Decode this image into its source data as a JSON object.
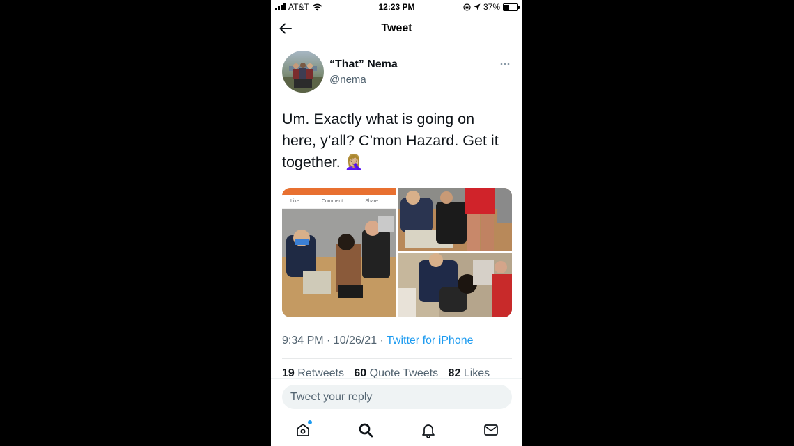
{
  "status_bar": {
    "carrier": "AT&T",
    "time": "12:23 PM",
    "battery": "37%",
    "battery_fraction": 0.37
  },
  "header": {
    "title": "Tweet"
  },
  "tweet": {
    "author_name": "“That” Nema",
    "author_handle": "@nema",
    "text": "Um. Exactly what is going on here, y’all? C’mon Hazard. Get it together. 🤦🏼‍♀️",
    "embedded_post_actions": [
      "Like",
      "Comment",
      "Share"
    ],
    "timestamp": "9:34 PM · 10/26/21 · ",
    "source": "Twitter for iPhone",
    "stats": {
      "retweets_count": "19",
      "retweets_label": "Retweets",
      "quotes_count": "60",
      "quotes_label": "Quote Tweets",
      "likes_count": "82",
      "likes_label": "Likes"
    }
  },
  "reply": {
    "placeholder": "Tweet your reply"
  },
  "tabbar": {
    "icons": [
      "home-icon",
      "search-icon",
      "notifications-icon",
      "messages-icon"
    ]
  },
  "colors": {
    "accent": "#1d9bf0",
    "text": "#0f1419",
    "secondary": "#536471"
  }
}
